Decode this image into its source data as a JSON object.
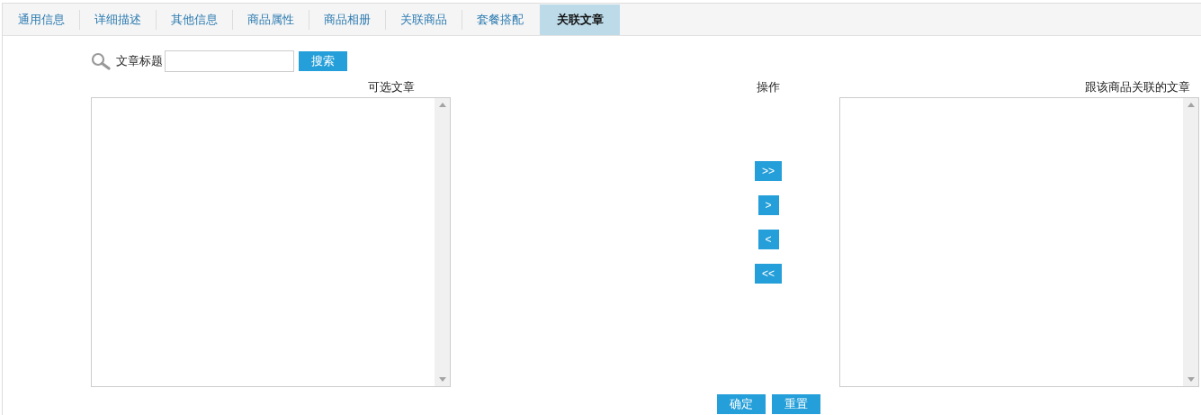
{
  "tabs": [
    {
      "label": "通用信息",
      "selected": false
    },
    {
      "label": "详细描述",
      "selected": false
    },
    {
      "label": "其他信息",
      "selected": false
    },
    {
      "label": "商品属性",
      "selected": false
    },
    {
      "label": "商品相册",
      "selected": false
    },
    {
      "label": "关联商品",
      "selected": false
    },
    {
      "label": "套餐搭配",
      "selected": false
    },
    {
      "label": "关联文章",
      "selected": true
    }
  ],
  "search": {
    "label": "文章标题",
    "button": "搜索"
  },
  "available_list": {
    "title": "可选文章"
  },
  "operations": {
    "title": "操作",
    "buttons": [
      ">>",
      ">",
      "<",
      "<<"
    ]
  },
  "linked_list": {
    "title": "跟该商品关联的文章"
  },
  "footer_buttons": [
    "确定",
    "重置"
  ]
}
